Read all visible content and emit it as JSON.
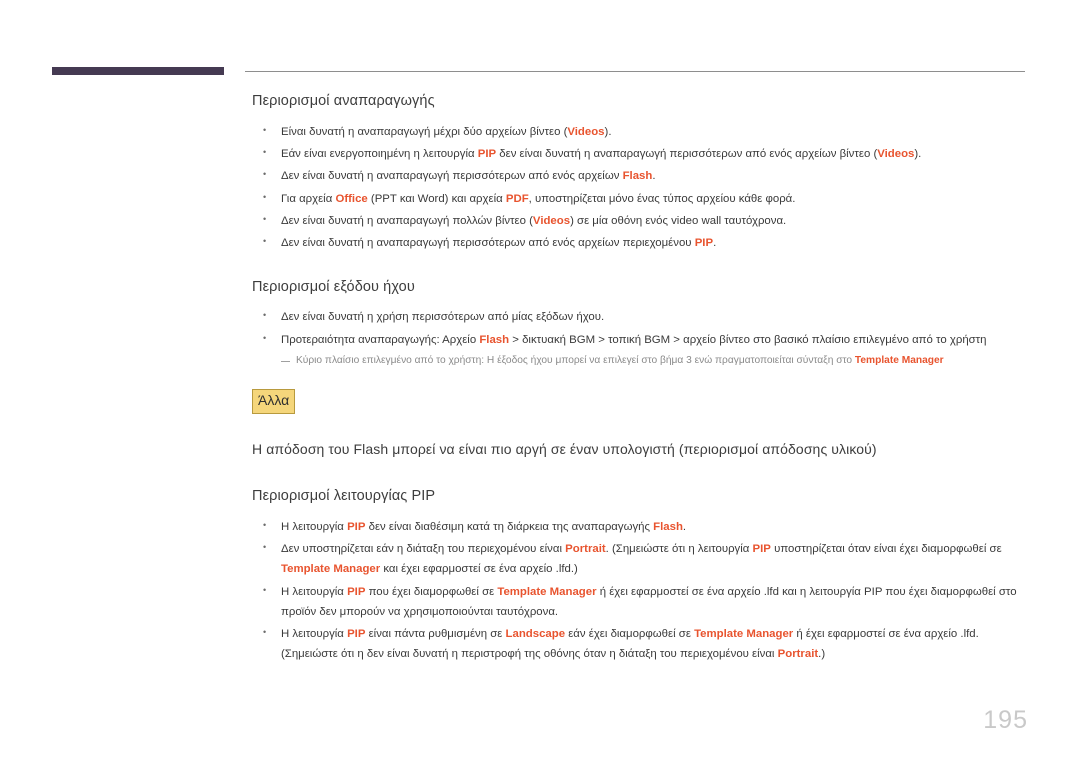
{
  "page": {
    "number": "195",
    "accent_color": "#e8542f",
    "header_bar_color": "#453a52",
    "highlight_bg_color": "#f5d67b",
    "highlight_border_color": "#b89a3e"
  },
  "sections": [
    {
      "id": "playback-limits",
      "heading": "Περιορισμοί αναπαραγωγής",
      "bullets": [
        [
          {
            "t": "Είναι δυνατή η αναπαραγωγή μέχρι δύο αρχείων βίντεο ("
          },
          {
            "t": "Videos",
            "accent": true
          },
          {
            "t": ")."
          }
        ],
        [
          {
            "t": "Εάν είναι ενεργοποιημένη η λειτουργία "
          },
          {
            "t": "PIP",
            "accent": true
          },
          {
            "t": " δεν είναι δυνατή η αναπαραγωγή περισσότερων από ενός αρχείων βίντεο ("
          },
          {
            "t": "Videos",
            "accent": true
          },
          {
            "t": ")."
          }
        ],
        [
          {
            "t": "Δεν είναι δυνατή η αναπαραγωγή περισσότερων από ενός αρχείων "
          },
          {
            "t": "Flash",
            "accent": true
          },
          {
            "t": "."
          }
        ],
        [
          {
            "t": "Για αρχεία "
          },
          {
            "t": "Office",
            "accent": true
          },
          {
            "t": " (PPT και Word) και αρχεία "
          },
          {
            "t": "PDF",
            "accent": true
          },
          {
            "t": ", υποστηρίζεται μόνο ένας τύπος αρχείου κάθε φορά."
          }
        ],
        [
          {
            "t": "Δεν είναι δυνατή η αναπαραγωγή πολλών βίντεο ("
          },
          {
            "t": "Videos",
            "accent": true
          },
          {
            "t": ") σε μία οθόνη ενός video wall ταυτόχρονα."
          }
        ],
        [
          {
            "t": "Δεν είναι δυνατή η αναπαραγωγή περισσότερων από ενός αρχείων περιεχομένου "
          },
          {
            "t": "PIP",
            "accent": true
          },
          {
            "t": "."
          }
        ]
      ],
      "notes": []
    },
    {
      "id": "audio-output-limits",
      "heading": "Περιορισμοί εξόδου ήχου",
      "bullets": [
        [
          {
            "t": "Δεν είναι δυνατή η χρήση περισσότερων από μίας εξόδων ήχου."
          }
        ],
        [
          {
            "t": "Προτεραιότητα αναπαραγωγής: Αρχείο "
          },
          {
            "t": "Flash",
            "accent": true
          },
          {
            "t": " > δικτυακή BGM > τοπική BGM > αρχείο βίντεο στο βασικό πλαίσιο επιλεγμένο από το χρήστη"
          }
        ]
      ],
      "notes": [
        [
          {
            "t": "Κύριο πλαίσιο επιλεγμένο από το χρήστη: Η έξοδος ήχου μπορεί να επιλεγεί στο βήμα 3 ενώ πραγματοποιείται σύνταξη στο "
          },
          {
            "t": "Template Manager",
            "accent": true
          }
        ]
      ]
    }
  ],
  "other_block": {
    "label": "Άλλα",
    "lead_paragraph": "Η απόδοση του Flash μπορεί να είναι πιο αργή σε έναν υπολογιστή (περιορισμοί απόδοσης υλικού)"
  },
  "pip_section": {
    "id": "pip-function-limits",
    "heading": "Περιορισμοί λειτουργίας PIP",
    "bullets": [
      [
        {
          "t": "Η λειτουργία "
        },
        {
          "t": "PIP",
          "accent": true
        },
        {
          "t": " δεν είναι διαθέσιμη κατά τη διάρκεια της αναπαραγωγής "
        },
        {
          "t": "Flash",
          "accent": true
        },
        {
          "t": "."
        }
      ],
      [
        {
          "t": "Δεν υποστηρίζεται εάν η διάταξη του περιεχομένου είναι "
        },
        {
          "t": "Portrait",
          "accent": true
        },
        {
          "t": ".  (Σημειώστε ότι η λειτουργία "
        },
        {
          "t": "PIP",
          "accent": true
        },
        {
          "t": " υποστηρίζεται όταν είναι έχει διαμορφωθεί σε "
        },
        {
          "t": "Template Manager",
          "accent": true
        },
        {
          "t": " και έχει εφαρμοστεί σε ένα αρχείο .lfd.)"
        }
      ],
      [
        {
          "t": "Η λειτουργία "
        },
        {
          "t": "PIP",
          "accent": true
        },
        {
          "t": " που έχει διαμορφωθεί σε "
        },
        {
          "t": "Template Manager",
          "accent": true
        },
        {
          "t": " ή έχει εφαρμοστεί σε ένα αρχείο .lfd και η λειτουργία PIP που έχει διαμορφωθεί στο προϊόν δεν μπορούν να χρησιμοποιούνται ταυτόχρονα."
        }
      ],
      [
        {
          "t": "Η λειτουργία "
        },
        {
          "t": "PIP",
          "accent": true
        },
        {
          "t": " είναι πάντα ρυθμισμένη σε "
        },
        {
          "t": "Landscape",
          "accent": true
        },
        {
          "t": " εάν έχει διαμορφωθεί σε "
        },
        {
          "t": "Template Manager",
          "accent": true
        },
        {
          "t": " ή έχει εφαρμοστεί σε ένα αρχείο .lfd. (Σημειώστε ότι η δεν είναι δυνατή η περιστροφή της οθόνης όταν η διάταξη του περιεχομένου είναι "
        },
        {
          "t": "Portrait",
          "accent": true
        },
        {
          "t": ".)"
        }
      ]
    ]
  }
}
